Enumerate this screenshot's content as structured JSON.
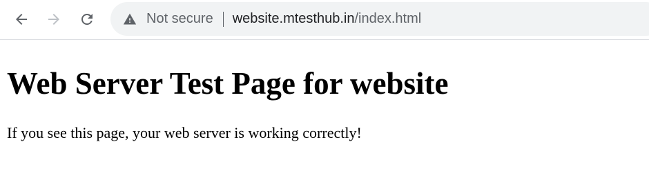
{
  "browser": {
    "security_label": "Not secure",
    "url_host": "website.mtesthub.in",
    "url_path": "/index.html",
    "icons": {
      "back": "arrow-left-icon",
      "forward": "arrow-right-icon",
      "reload": "reload-icon",
      "security": "warning-triangle-icon"
    },
    "forward_enabled": false
  },
  "page": {
    "heading": "Web Server Test Page for website",
    "message": "If you see this page, your web server is working correctly!"
  },
  "colors": {
    "omnibox_bg": "#f1f3f4",
    "icon_active": "#5f6368",
    "icon_disabled": "#bdc1c6",
    "url_host": "#202124",
    "text": "#000000"
  }
}
